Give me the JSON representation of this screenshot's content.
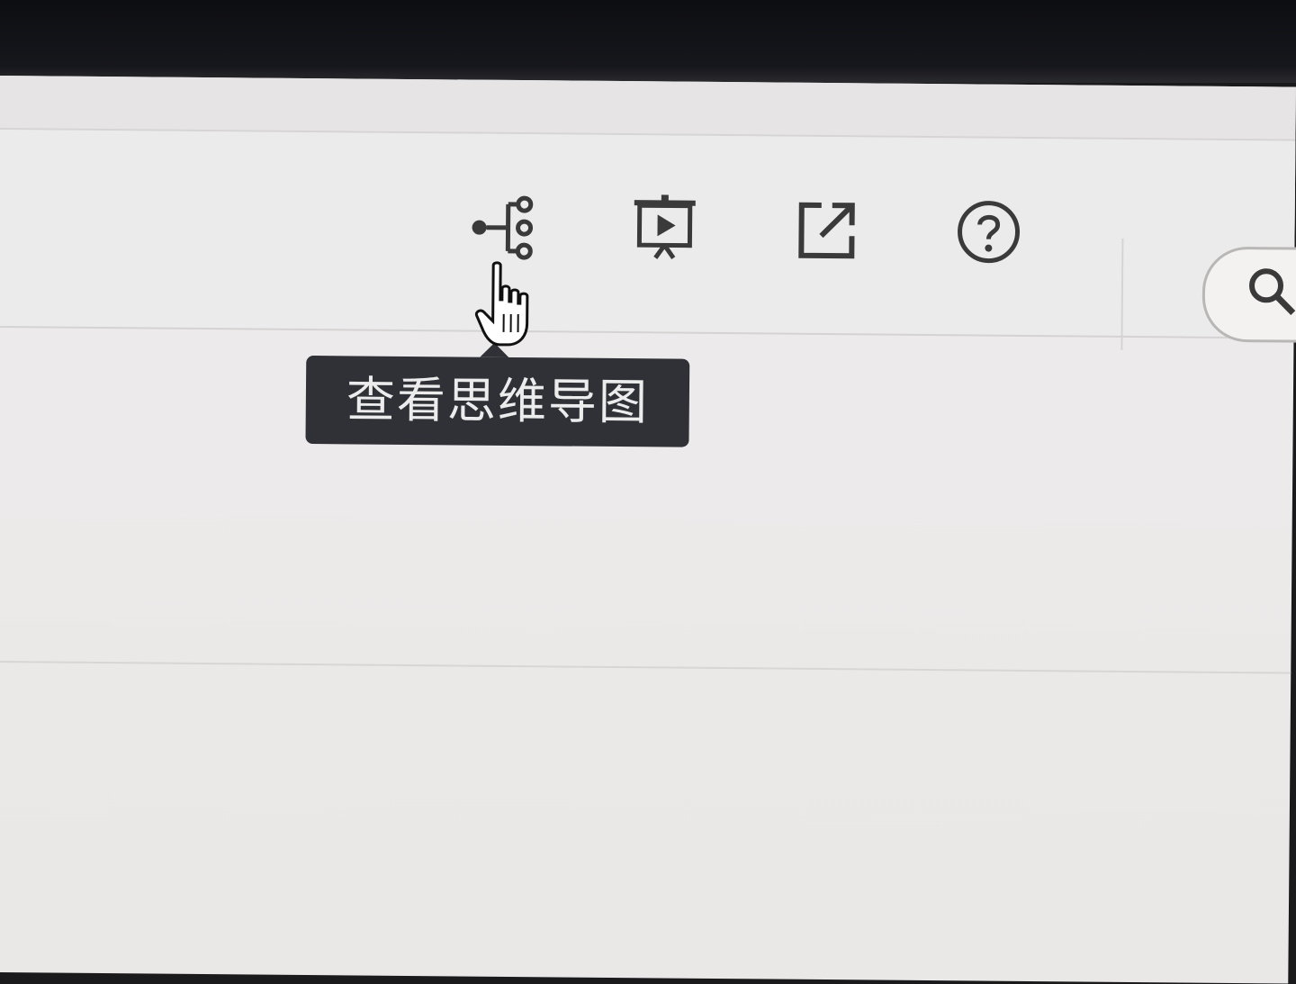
{
  "toolbar": {
    "buttons": [
      {
        "icon": "mind-map-icon"
      },
      {
        "icon": "presentation-play-icon"
      },
      {
        "icon": "external-link-icon"
      },
      {
        "icon": "help-circle-icon"
      }
    ],
    "search": {
      "icon": "search-icon"
    }
  },
  "tooltip": {
    "text": "查看思维导图"
  },
  "colors": {
    "icon": "#3a3a3a",
    "tooltip_bg": "#2f3136",
    "tooltip_text": "#ececec",
    "page_bg": "#ecebeb"
  }
}
